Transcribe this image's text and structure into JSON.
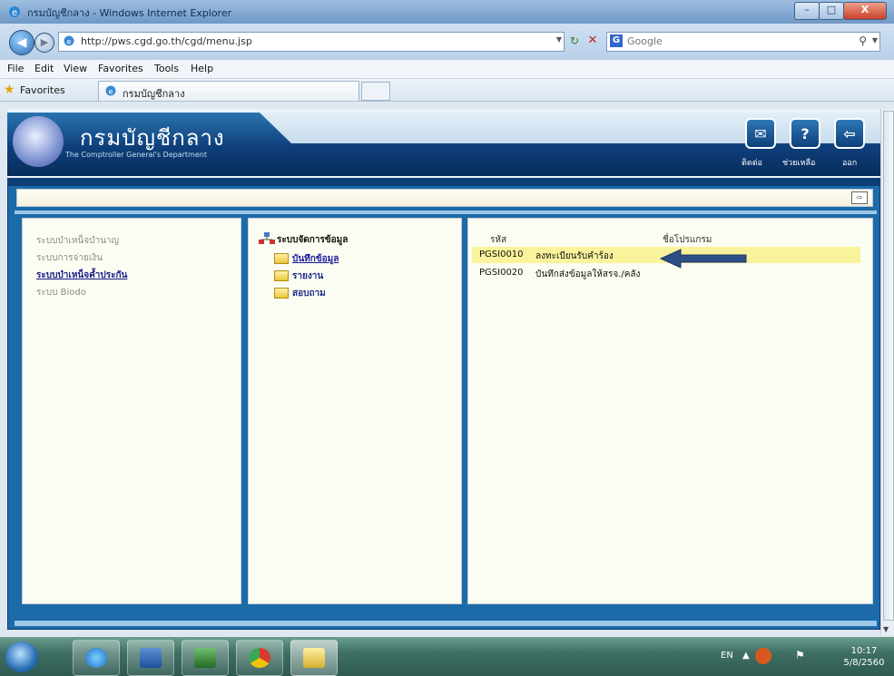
{
  "window": {
    "title": "กรมบัญชีกลาง - Windows Internet Explorer",
    "min": "–",
    "max": "□",
    "close": "X"
  },
  "nav": {
    "back": "◀",
    "forward": "▶",
    "address": "http://pws.cgd.go.th/cgd/menu.jsp",
    "search_engine": "Google",
    "search_placeholder": "Google"
  },
  "menu": [
    "File",
    "Edit",
    "View",
    "Favorites",
    "Tools",
    "Help"
  ],
  "favorites": {
    "label": "Favorites",
    "tab_label": "กรมบัญชีกลาง"
  },
  "header": {
    "dept_th": "กรมบัญชีกลาง",
    "dept_en": "The Comptroller General's Department",
    "icons": [
      {
        "icon": "mail-icon",
        "label": "ติดต่อ"
      },
      {
        "icon": "help-icon",
        "label": "ช่วยเหลือ"
      },
      {
        "icon": "exit-icon",
        "label": "ออก"
      }
    ]
  },
  "left_menu": [
    {
      "label": "ระบบบำเหน็จบำนาญ",
      "active": false
    },
    {
      "label": "ระบบการจ่ายเงิน",
      "active": false
    },
    {
      "label": "ระบบบำเหน็จค้ำประกัน",
      "active": true
    },
    {
      "label": "ระบบ Biodo",
      "active": false
    }
  ],
  "tree": {
    "root": "ระบบจัดการข้อมูล",
    "items": [
      {
        "label": "บันทึกข้อมูล",
        "selected": true
      },
      {
        "label": "รายงาน",
        "selected": false
      },
      {
        "label": "สอบถาม",
        "selected": false
      }
    ]
  },
  "programs": {
    "col_code": "รหัส",
    "col_name": "ชื่อโปรแกรม",
    "rows": [
      {
        "code": "PGSI0010",
        "name": "ลงทะเบียนรับคำร้อง",
        "highlighted": true
      },
      {
        "code": "PGSI0020",
        "name": "บันทึกส่งข้อมูลให้สรจ./คลัง",
        "highlighted": false
      }
    ]
  },
  "taskbar": {
    "lang": "EN",
    "time": "10:17",
    "date": "5/8/2560"
  },
  "colors": {
    "accent": "#0e3f7a",
    "highlight_row": "#f9f39c",
    "arrow": "#2c4f86"
  }
}
